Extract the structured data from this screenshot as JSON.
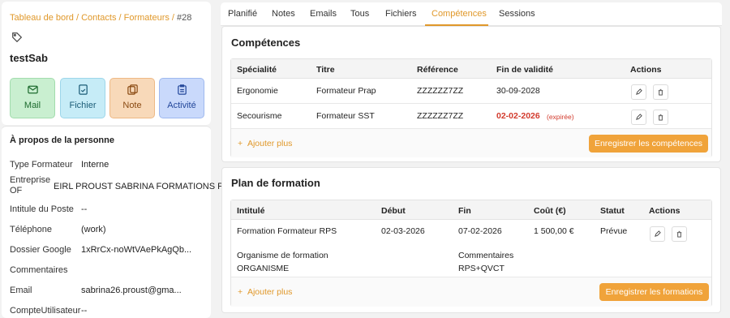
{
  "breadcrumb": {
    "path": "Tableau de bord / Contacts / Formateurs / ",
    "current": "#28"
  },
  "profile": {
    "name": "testSab"
  },
  "actions": {
    "mail": "Mail",
    "fichier": "Fichier",
    "note": "Note",
    "activite": "Activité"
  },
  "about": {
    "title": "À propos de la personne",
    "rows": [
      {
        "label": "Type Formateur",
        "value": "Interne"
      },
      {
        "label": "Entreprise OF",
        "value": "EIRL PROUST SABRINA FORMATIONS PIST"
      },
      {
        "label": "Intitule du Poste",
        "value": "--"
      },
      {
        "label": "Téléphone",
        "value": "(work)"
      },
      {
        "label": "Dossier Google",
        "value": "1xRrCx-noWtVAePkAgQb..."
      },
      {
        "label": "Commentaires",
        "value": ""
      },
      {
        "label": "Email",
        "value": "sabrina26.proust@gma..."
      },
      {
        "label": "CompteUtilisateur",
        "value": "--"
      }
    ]
  },
  "tabs": [
    "Planifié",
    "Notes",
    "Emails",
    "Tous",
    "Fichiers",
    "Compétences",
    "Sessions"
  ],
  "competences": {
    "title": "Compétences",
    "headers": [
      "Spécialité",
      "Titre",
      "Référence",
      "Fin de validité",
      "Actions"
    ],
    "rows": [
      {
        "specialite": "Ergonomie",
        "titre": "Formateur Prap",
        "reference": "ZZZZZZ7ZZ",
        "fin": "30-09-2028",
        "note": ""
      },
      {
        "specialite": "Secourisme",
        "titre": "Formateur SST",
        "reference": "ZZZZZZ7ZZ",
        "fin": "02-02-2026",
        "note": "(expirée)"
      }
    ],
    "add_label": "Ajouter plus",
    "save_label": "Enregistrer les compétences"
  },
  "plan": {
    "title": "Plan de formation",
    "headers": [
      "Intitulé",
      "Début",
      "Fin",
      "Coût (€)",
      "Statut",
      "Actions"
    ],
    "rows": [
      {
        "intitule": "Formation Formateur RPS",
        "debut": "02-03-2026",
        "fin": "07-02-2026",
        "cout": "1 500,00 €",
        "statut": "Prévue"
      }
    ],
    "organisme_label": "Organisme de formation",
    "organisme_value": "ORGANISME",
    "commentaires_label": "Commentaires",
    "commentaires_value": "RPS+QVCT",
    "add_label": "Ajouter plus",
    "save_label": "Enregistrer les formations"
  },
  "colors": {
    "accent": "#e0982a",
    "save": "#f0a33a",
    "expired": "#d23a2c"
  }
}
